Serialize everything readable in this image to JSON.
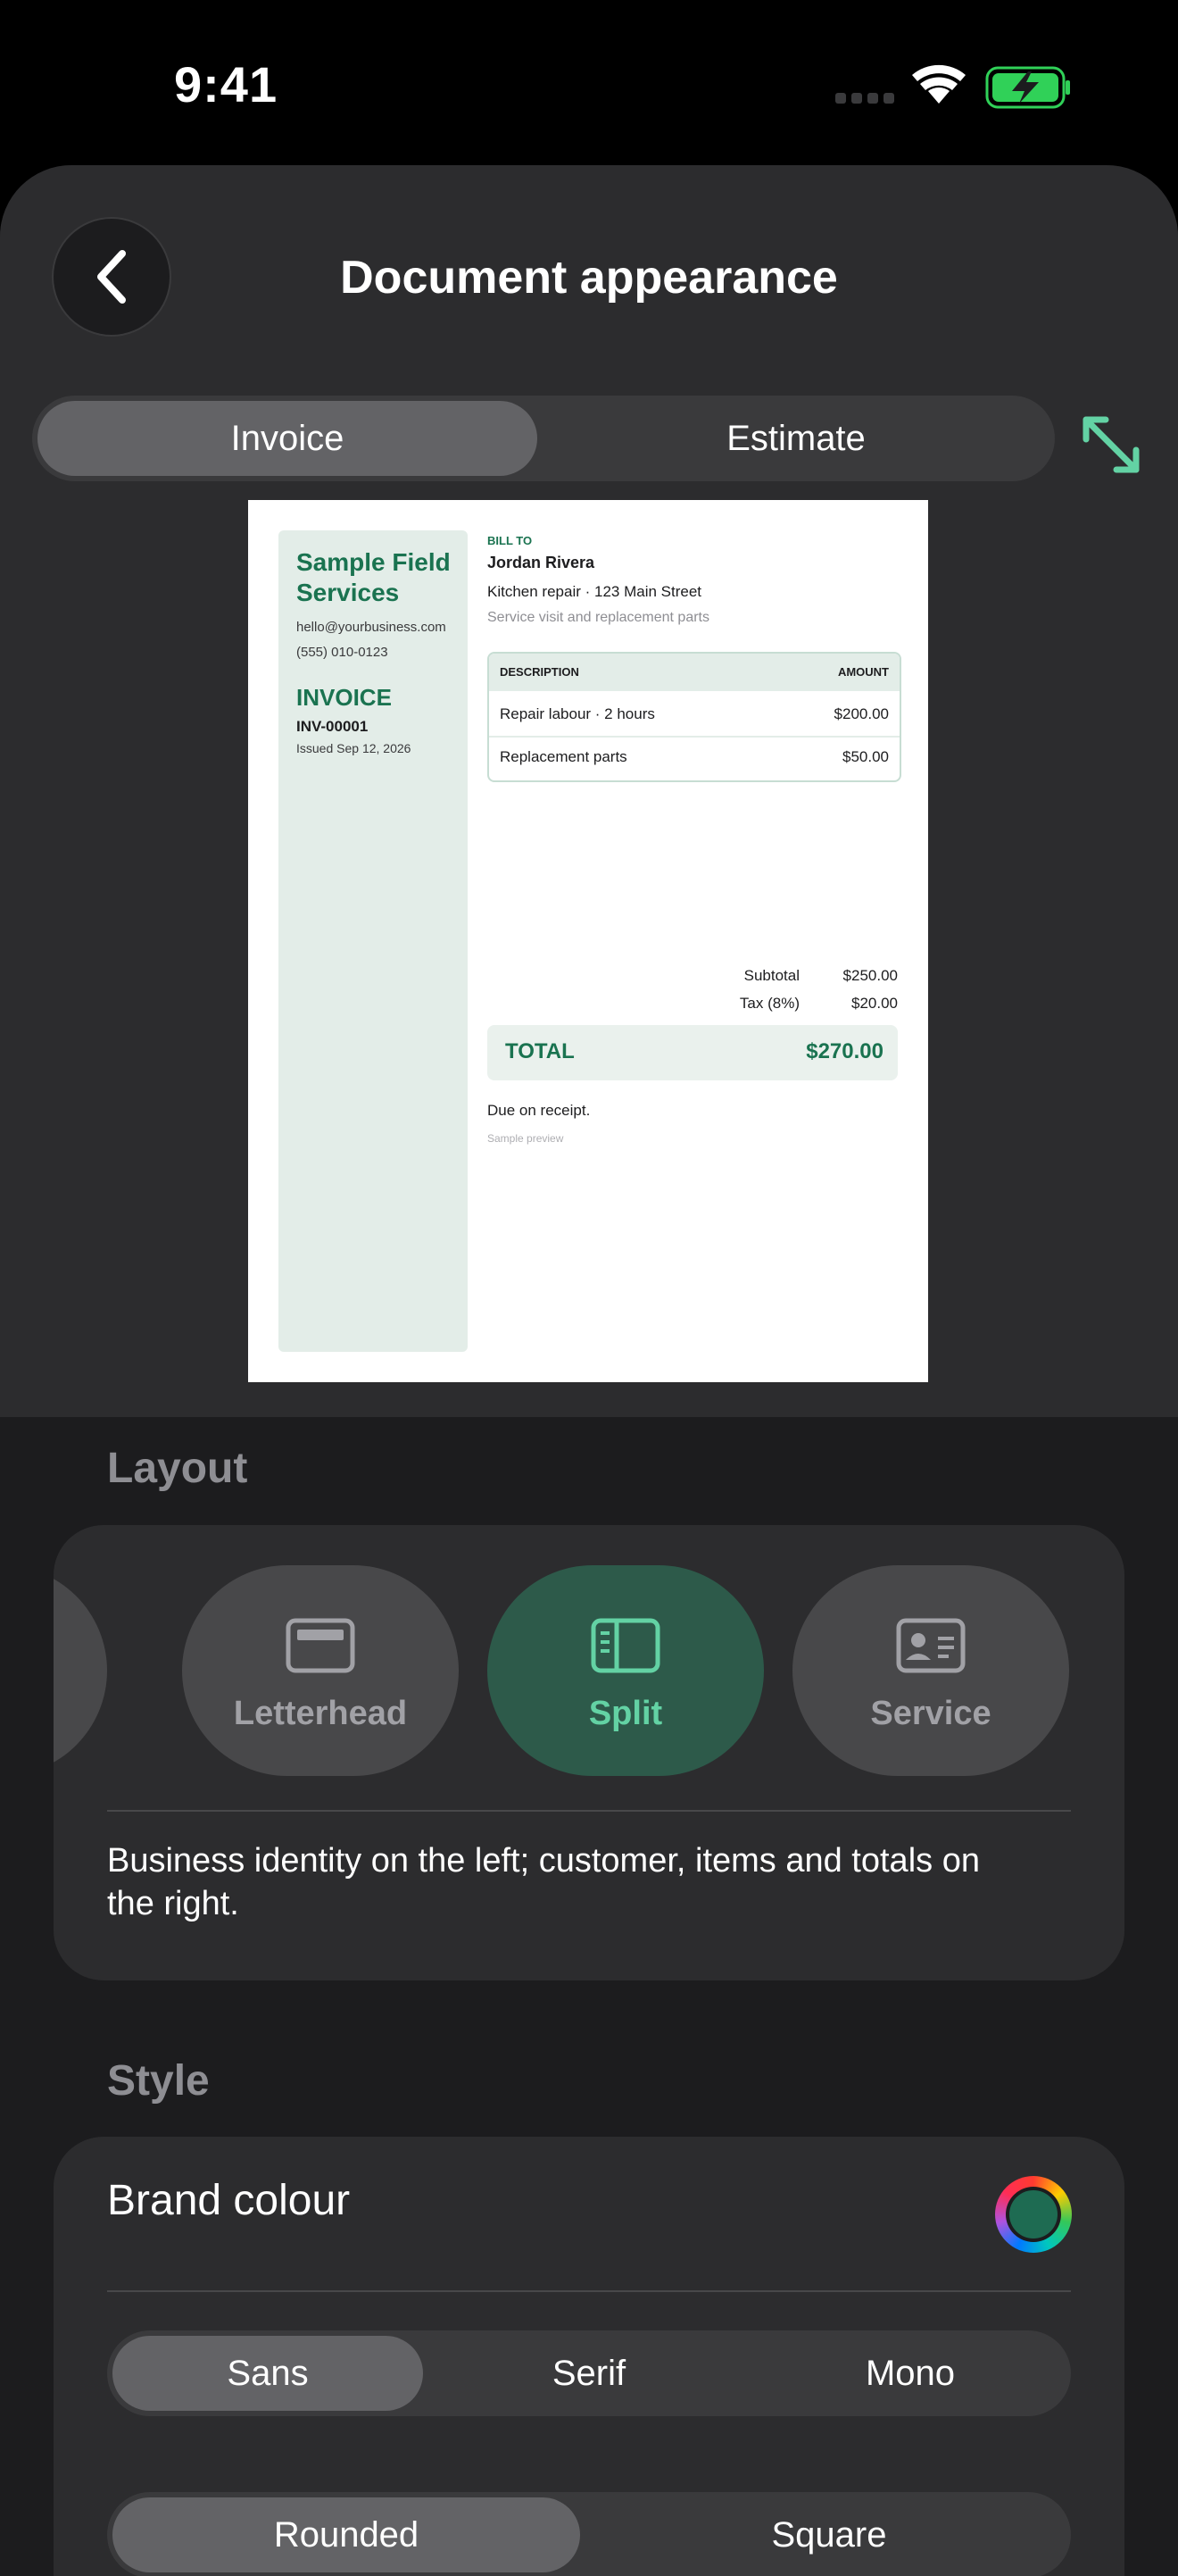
{
  "status_bar": {
    "time": "9:41",
    "icons": [
      "cellular-icon",
      "wifi-icon",
      "battery-charging-icon"
    ]
  },
  "header": {
    "title": "Document appearance",
    "back_icon": "chevron-left-icon",
    "expand_icon": "expand-arrows-icon"
  },
  "document_type": {
    "options": [
      "Invoice",
      "Estimate"
    ],
    "selected": "Invoice"
  },
  "preview": {
    "business_name_line1": "Sample Field",
    "business_name_line2": "Services",
    "email": "hello@yourbusiness.com",
    "phone": "(555) 010-0123",
    "doc_title": "INVOICE",
    "doc_number": "INV-00001",
    "issued": "Issued Sep 12, 2026",
    "bill_to_label": "BILL TO",
    "customer_name": "Jordan Rivera",
    "job_line": "Kitchen repair · 123 Main Street",
    "job_note": "Service visit and replacement parts",
    "col_description": "DESCRIPTION",
    "col_amount": "AMOUNT",
    "line_items": [
      {
        "description": "Repair labour · 2 hours",
        "amount": "$200.00"
      },
      {
        "description": "Replacement parts",
        "amount": "$50.00"
      }
    ],
    "subtotal_label": "Subtotal",
    "subtotal": "$250.00",
    "tax_label": "Tax (8%)",
    "tax": "$20.00",
    "total_label": "TOTAL",
    "total": "$270.00",
    "due_note": "Due on receipt.",
    "sample_note": "Sample preview"
  },
  "layout": {
    "heading": "Layout",
    "options": [
      {
        "label": "Letterhead",
        "icon": "letterhead-layout-icon"
      },
      {
        "label": "Split",
        "icon": "split-layout-icon"
      },
      {
        "label": "Service",
        "icon": "service-card-icon"
      }
    ],
    "selected": "Split",
    "description": "Business identity on the left; customer, items and totals on the right."
  },
  "style": {
    "heading": "Style",
    "brand_colour_label": "Brand colour",
    "brand_colour": "#1e6b52",
    "font_options": [
      "Sans",
      "Serif",
      "Mono"
    ],
    "font_selected": "Sans",
    "corner_options": [
      "Rounded",
      "Square"
    ],
    "corner_selected": "Rounded"
  },
  "colors": {
    "accent": "#1a7350",
    "accent_light": "#63d2a4",
    "selected_pill": "#2d5a4a"
  }
}
